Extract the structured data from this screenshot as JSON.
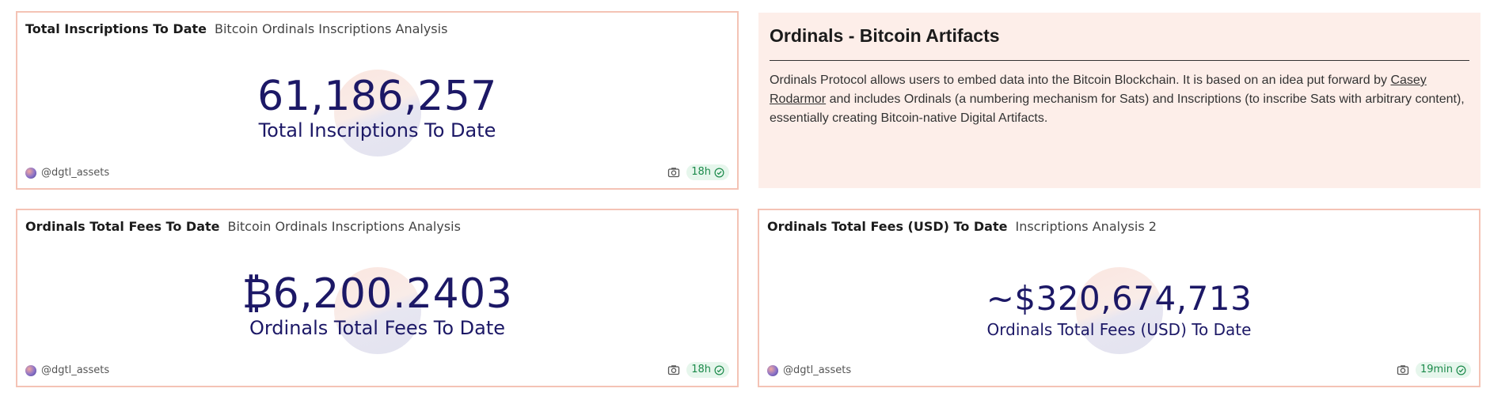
{
  "cards": [
    {
      "title": "Total Inscriptions To Date",
      "subtitle": "Bitcoin Ordinals Inscriptions Analysis",
      "value": "61,186,257",
      "label": "Total Inscriptions To Date",
      "author": "@dgtl_assets",
      "age": "18h"
    },
    {
      "title": "Ordinals Total Fees To Date",
      "subtitle": "Bitcoin Ordinals Inscriptions Analysis",
      "value": "₿6,200.2403",
      "label": "Ordinals Total Fees To Date",
      "author": "@dgtl_assets",
      "age": "18h"
    },
    {
      "title": "Ordinals Total Fees (USD) To Date",
      "subtitle": "Inscriptions Analysis 2",
      "value": "~$320,674,713",
      "label": "Ordinals Total Fees (USD) To Date",
      "author": "@dgtl_assets",
      "age": "19min"
    }
  ],
  "text_card": {
    "heading": "Ordinals - Bitcoin Artifacts",
    "body_before": "Ordinals Protocol allows users to embed data into the Bitcoin Blockchain. It is based on an idea put forward by ",
    "link": "Casey Rodarmor",
    "body_after": " and includes Ordinals (a numbering mechanism for Sats) and Inscriptions (to inscribe Sats with arbitrary content), essentially creating Bitcoin-native Digital Artifacts."
  },
  "colors": {
    "border": "#f4c3b5",
    "value_text": "#1c1866",
    "text_card_bg": "#fdeee9",
    "badge_bg": "#e6f6ec",
    "badge_text": "#1c8a4b"
  },
  "icons": [
    "user-avatar",
    "camera-icon",
    "check-circle-icon"
  ]
}
